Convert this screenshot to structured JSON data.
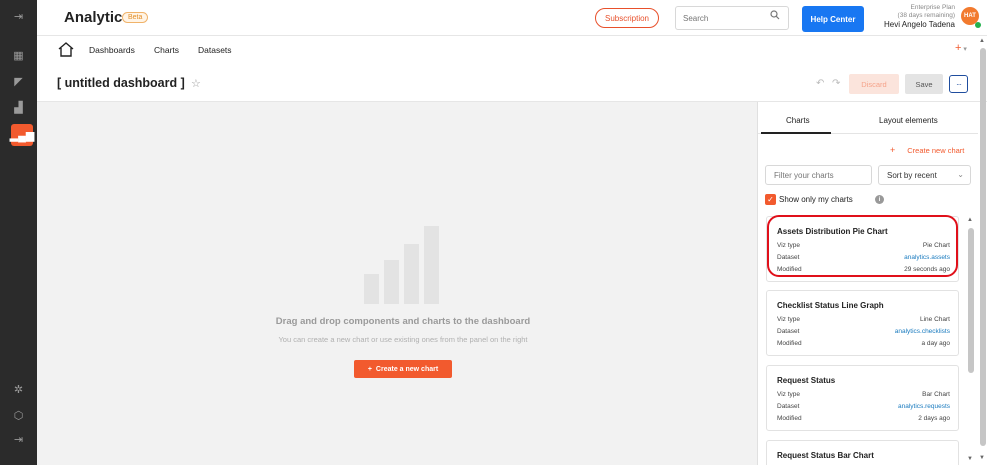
{
  "header": {
    "brand": "Analytics",
    "beta": "Beta",
    "subscription": "Subscription",
    "search_placeholder": "Search",
    "help": "Help Center",
    "plan": "Enterprise Plan",
    "remaining": "(38 days remaining)",
    "user_name": "Hevi Angelo Tadena",
    "avatar_initials": "HAT"
  },
  "nav": {
    "links": [
      "Dashboards",
      "Charts",
      "Datasets"
    ],
    "add": "+"
  },
  "title_bar": {
    "title": "[ untitled dashboard ]",
    "discard": "Discard",
    "save": "Save",
    "more": "···"
  },
  "canvas": {
    "empty_title": "Drag and drop components and charts to the dashboard",
    "empty_sub": "You can create a new chart or use existing ones from the panel on the right",
    "create_button": "Create a new chart"
  },
  "panel": {
    "tabs": [
      "Charts",
      "Layout elements"
    ],
    "create_new_chart": "Create new chart",
    "filter_placeholder": "Filter your charts",
    "sort_value": "Sort by recent",
    "show_only_mine": "Show only my charts",
    "labels": {
      "viz": "Viz type",
      "dataset": "Dataset",
      "modified": "Modified"
    },
    "cards": [
      {
        "title": "Assets Distribution Pie Chart",
        "viz": "Pie Chart",
        "dataset": "analytics.assets",
        "modified": "29 seconds ago"
      },
      {
        "title": "Checklist Status Line Graph",
        "viz": "Line Chart",
        "dataset": "analytics.checklists",
        "modified": "a day ago"
      },
      {
        "title": "Request Status",
        "viz": "Bar Chart",
        "dataset": "analytics.requests",
        "modified": "2 days ago"
      },
      {
        "title": "Request Status Bar Chart"
      }
    ]
  },
  "colors": {
    "accent": "#f25a2e",
    "primary_blue": "#1877f2",
    "rail": "#2b2b2b",
    "link": "#1a7bbf",
    "highlight": "#e0101a"
  }
}
